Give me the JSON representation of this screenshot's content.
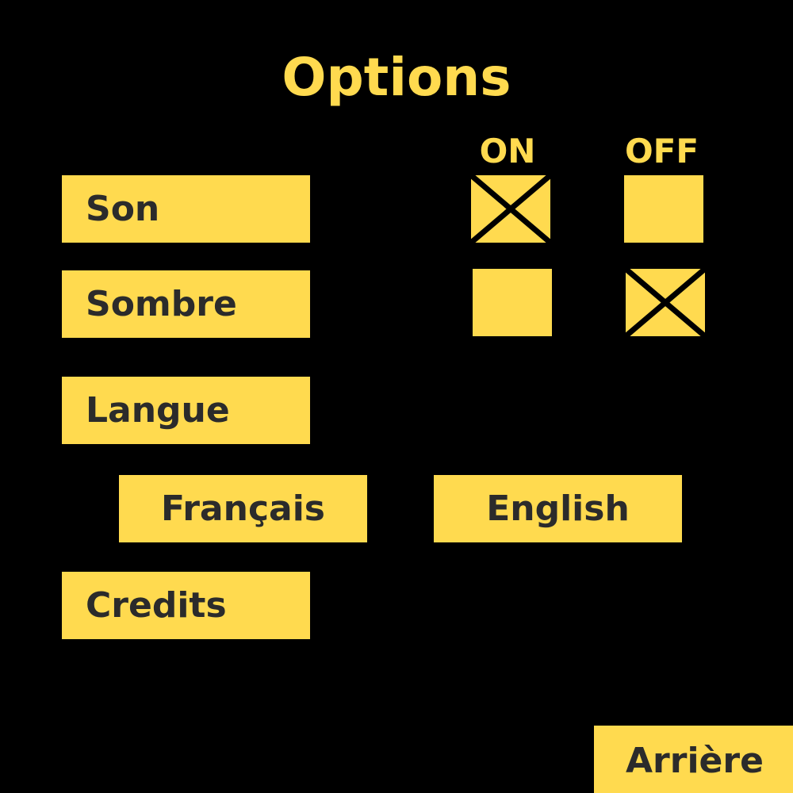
{
  "page": {
    "title": "Options"
  },
  "columns": {
    "on": "ON",
    "off": "OFF"
  },
  "settings": [
    {
      "label": "Son",
      "on_checked": true,
      "off_checked": false
    },
    {
      "label": "Sombre",
      "on_checked": false,
      "off_checked": true
    }
  ],
  "language": {
    "label": "Langue",
    "options": [
      "Français",
      "English"
    ]
  },
  "credits": {
    "label": "Credits"
  },
  "back": {
    "label": "Arrière"
  },
  "colors": {
    "background": "#000000",
    "accent": "#FFDA4F",
    "text_dark": "#2B2B2B"
  },
  "icons": {
    "checked": "x-mark-icon"
  }
}
